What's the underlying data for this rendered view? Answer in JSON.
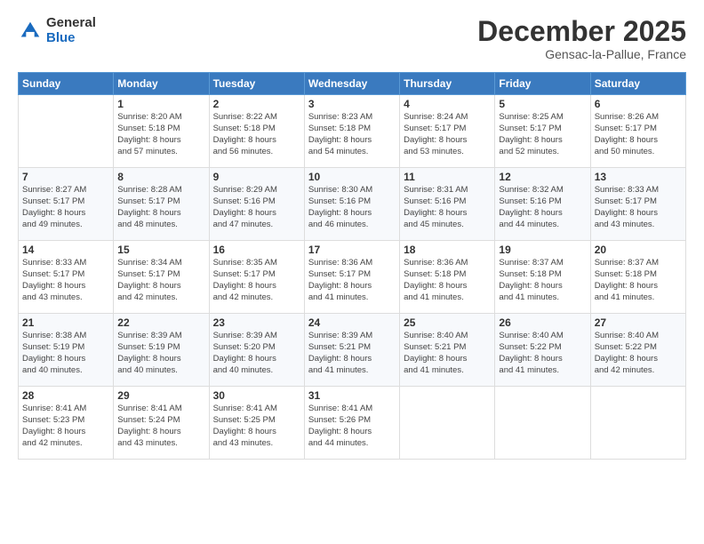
{
  "logo": {
    "general": "General",
    "blue": "Blue"
  },
  "title": {
    "month": "December 2025",
    "location": "Gensac-la-Pallue, France"
  },
  "headers": [
    "Sunday",
    "Monday",
    "Tuesday",
    "Wednesday",
    "Thursday",
    "Friday",
    "Saturday"
  ],
  "weeks": [
    [
      {
        "day": "",
        "info": ""
      },
      {
        "day": "1",
        "info": "Sunrise: 8:20 AM\nSunset: 5:18 PM\nDaylight: 8 hours\nand 57 minutes."
      },
      {
        "day": "2",
        "info": "Sunrise: 8:22 AM\nSunset: 5:18 PM\nDaylight: 8 hours\nand 56 minutes."
      },
      {
        "day": "3",
        "info": "Sunrise: 8:23 AM\nSunset: 5:18 PM\nDaylight: 8 hours\nand 54 minutes."
      },
      {
        "day": "4",
        "info": "Sunrise: 8:24 AM\nSunset: 5:17 PM\nDaylight: 8 hours\nand 53 minutes."
      },
      {
        "day": "5",
        "info": "Sunrise: 8:25 AM\nSunset: 5:17 PM\nDaylight: 8 hours\nand 52 minutes."
      },
      {
        "day": "6",
        "info": "Sunrise: 8:26 AM\nSunset: 5:17 PM\nDaylight: 8 hours\nand 50 minutes."
      }
    ],
    [
      {
        "day": "7",
        "info": "Sunrise: 8:27 AM\nSunset: 5:17 PM\nDaylight: 8 hours\nand 49 minutes."
      },
      {
        "day": "8",
        "info": "Sunrise: 8:28 AM\nSunset: 5:17 PM\nDaylight: 8 hours\nand 48 minutes."
      },
      {
        "day": "9",
        "info": "Sunrise: 8:29 AM\nSunset: 5:16 PM\nDaylight: 8 hours\nand 47 minutes."
      },
      {
        "day": "10",
        "info": "Sunrise: 8:30 AM\nSunset: 5:16 PM\nDaylight: 8 hours\nand 46 minutes."
      },
      {
        "day": "11",
        "info": "Sunrise: 8:31 AM\nSunset: 5:16 PM\nDaylight: 8 hours\nand 45 minutes."
      },
      {
        "day": "12",
        "info": "Sunrise: 8:32 AM\nSunset: 5:16 PM\nDaylight: 8 hours\nand 44 minutes."
      },
      {
        "day": "13",
        "info": "Sunrise: 8:33 AM\nSunset: 5:17 PM\nDaylight: 8 hours\nand 43 minutes."
      }
    ],
    [
      {
        "day": "14",
        "info": "Sunrise: 8:33 AM\nSunset: 5:17 PM\nDaylight: 8 hours\nand 43 minutes."
      },
      {
        "day": "15",
        "info": "Sunrise: 8:34 AM\nSunset: 5:17 PM\nDaylight: 8 hours\nand 42 minutes."
      },
      {
        "day": "16",
        "info": "Sunrise: 8:35 AM\nSunset: 5:17 PM\nDaylight: 8 hours\nand 42 minutes."
      },
      {
        "day": "17",
        "info": "Sunrise: 8:36 AM\nSunset: 5:17 PM\nDaylight: 8 hours\nand 41 minutes."
      },
      {
        "day": "18",
        "info": "Sunrise: 8:36 AM\nSunset: 5:18 PM\nDaylight: 8 hours\nand 41 minutes."
      },
      {
        "day": "19",
        "info": "Sunrise: 8:37 AM\nSunset: 5:18 PM\nDaylight: 8 hours\nand 41 minutes."
      },
      {
        "day": "20",
        "info": "Sunrise: 8:37 AM\nSunset: 5:18 PM\nDaylight: 8 hours\nand 41 minutes."
      }
    ],
    [
      {
        "day": "21",
        "info": "Sunrise: 8:38 AM\nSunset: 5:19 PM\nDaylight: 8 hours\nand 40 minutes."
      },
      {
        "day": "22",
        "info": "Sunrise: 8:39 AM\nSunset: 5:19 PM\nDaylight: 8 hours\nand 40 minutes."
      },
      {
        "day": "23",
        "info": "Sunrise: 8:39 AM\nSunset: 5:20 PM\nDaylight: 8 hours\nand 40 minutes."
      },
      {
        "day": "24",
        "info": "Sunrise: 8:39 AM\nSunset: 5:21 PM\nDaylight: 8 hours\nand 41 minutes."
      },
      {
        "day": "25",
        "info": "Sunrise: 8:40 AM\nSunset: 5:21 PM\nDaylight: 8 hours\nand 41 minutes."
      },
      {
        "day": "26",
        "info": "Sunrise: 8:40 AM\nSunset: 5:22 PM\nDaylight: 8 hours\nand 41 minutes."
      },
      {
        "day": "27",
        "info": "Sunrise: 8:40 AM\nSunset: 5:22 PM\nDaylight: 8 hours\nand 42 minutes."
      }
    ],
    [
      {
        "day": "28",
        "info": "Sunrise: 8:41 AM\nSunset: 5:23 PM\nDaylight: 8 hours\nand 42 minutes."
      },
      {
        "day": "29",
        "info": "Sunrise: 8:41 AM\nSunset: 5:24 PM\nDaylight: 8 hours\nand 43 minutes."
      },
      {
        "day": "30",
        "info": "Sunrise: 8:41 AM\nSunset: 5:25 PM\nDaylight: 8 hours\nand 43 minutes."
      },
      {
        "day": "31",
        "info": "Sunrise: 8:41 AM\nSunset: 5:26 PM\nDaylight: 8 hours\nand 44 minutes."
      },
      {
        "day": "",
        "info": ""
      },
      {
        "day": "",
        "info": ""
      },
      {
        "day": "",
        "info": ""
      }
    ]
  ]
}
